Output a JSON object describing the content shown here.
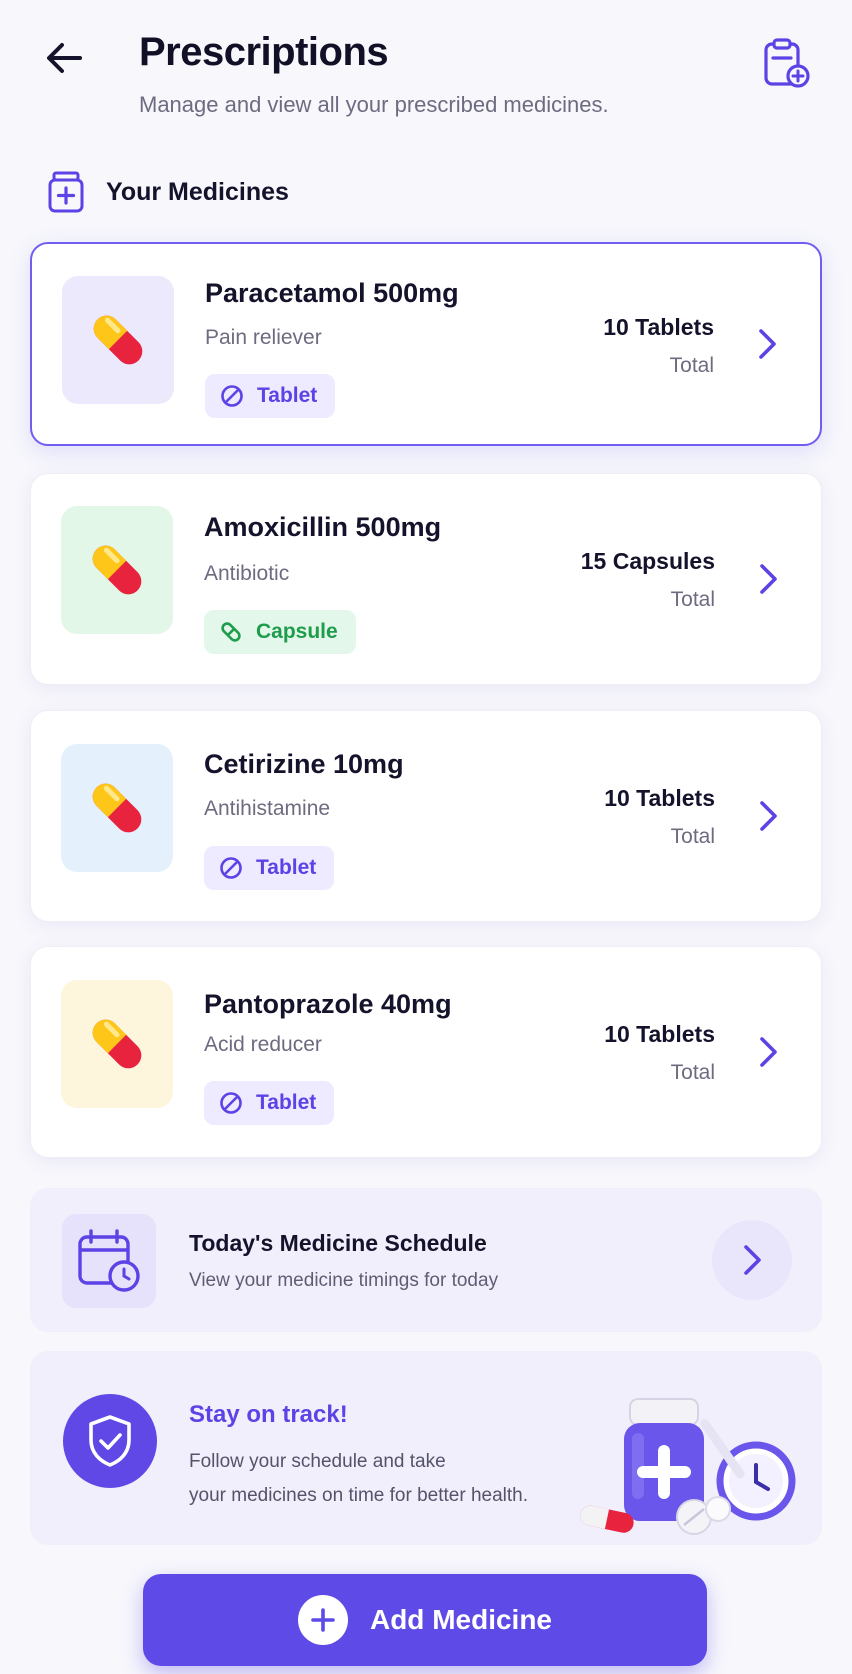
{
  "header": {
    "title": "Prescriptions",
    "subtitle": "Manage and view all your prescribed medicines.",
    "back_icon": "arrow-left-icon",
    "action_icon": "document-add-icon"
  },
  "section": {
    "title": "Your Medicines",
    "icon": "medicine-bottle-icon"
  },
  "medicines": [
    {
      "name": "Paracetamol 500mg",
      "description": "Pain reliever",
      "form": "Tablet",
      "form_icon": "tablet-icon",
      "quantity": "10 Tablets",
      "quantity_label": "Total",
      "thumb_color": "#ede9fd",
      "selected": true
    },
    {
      "name": "Amoxicillin 500mg",
      "description": "Antibiotic",
      "form": "Capsule",
      "form_icon": "capsule-icon",
      "quantity": "15 Capsules",
      "quantity_label": "Total",
      "thumb_color": "#e3f7e8",
      "selected": false
    },
    {
      "name": "Cetirizine 10mg",
      "description": "Antihistamine",
      "form": "Tablet",
      "form_icon": "tablet-icon",
      "quantity": "10 Tablets",
      "quantity_label": "Total",
      "thumb_color": "#e5f0fd",
      "selected": false
    },
    {
      "name": "Pantoprazole 40mg",
      "description": "Acid reducer",
      "form": "Tablet",
      "form_icon": "tablet-icon",
      "quantity": "10 Tablets",
      "quantity_label": "Total",
      "thumb_color": "#fdf5dc",
      "selected": false
    }
  ],
  "schedule": {
    "title": "Today's Medicine Schedule",
    "subtitle": "View your medicine timings for today",
    "icon": "calendar-clock-icon"
  },
  "tip": {
    "title": "Stay on track!",
    "line1": "Follow your schedule and take",
    "line2": "your medicines on time for better health.",
    "icon": "shield-check-icon"
  },
  "cta": {
    "label": "Add Medicine",
    "icon": "plus-circle-icon"
  },
  "colors": {
    "accent": "#5e4ae6",
    "tablet_chip": "#eeeaff",
    "capsule_chip": "#e3f8ea",
    "background": "#f7f7fc"
  }
}
